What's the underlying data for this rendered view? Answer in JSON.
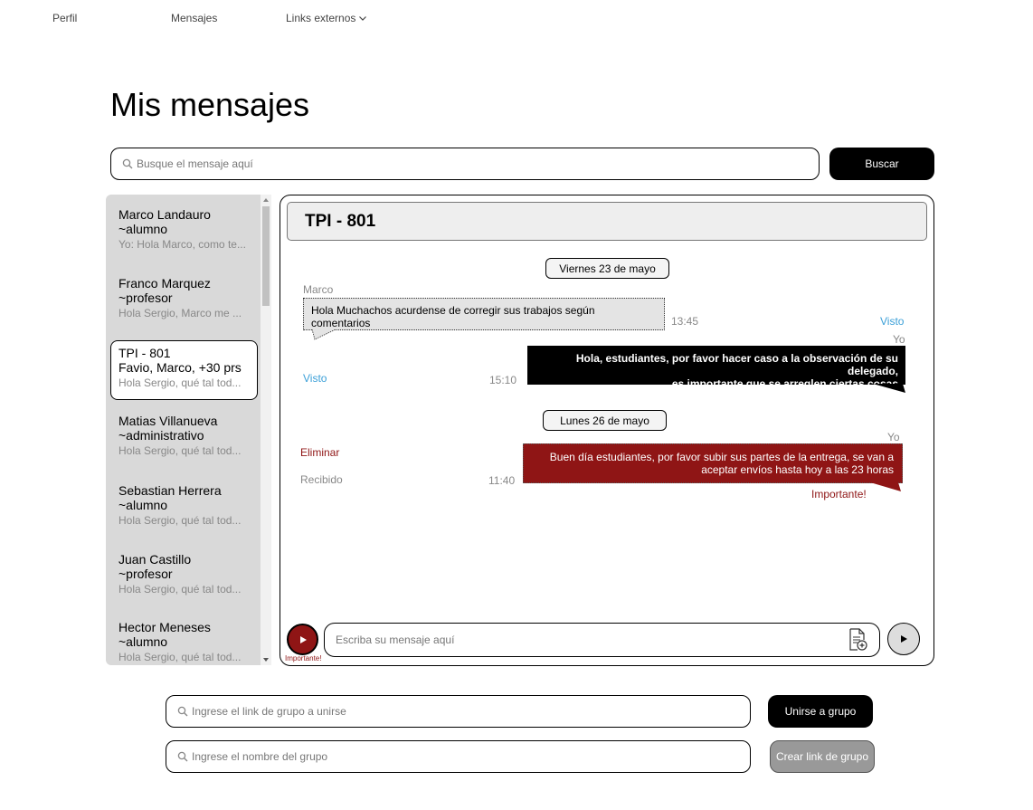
{
  "nav": {
    "perfil": "Perfil",
    "mensajes": "Mensajes",
    "links_externos": "Links externos"
  },
  "page_title": "Mis mensajes",
  "search": {
    "placeholder": "Busque el mensaje aquí",
    "button_label": "Buscar"
  },
  "contacts": [
    {
      "name": "Marco Landauro",
      "role": "~alumno",
      "preview": "Yo: Hola Marco, como te..."
    },
    {
      "name": "Franco Marquez",
      "role": "~profesor",
      "preview": "Hola Sergio, Marco me ..."
    },
    {
      "name": "TPI - 801",
      "role": "Favio, Marco, +30 prs",
      "preview": "Hola Sergio, qué tal tod..."
    },
    {
      "name": "Matias Villanueva",
      "role": "~administrativo",
      "preview": "Hola Sergio, qué tal tod..."
    },
    {
      "name": "Sebastian Herrera",
      "role": "~alumno",
      "preview": "Hola Sergio, qué tal tod..."
    },
    {
      "name": "Juan Castillo",
      "role": "~profesor",
      "preview": "Hola Sergio, qué tal tod..."
    },
    {
      "name": "Hector Meneses",
      "role": "~alumno",
      "preview": "Hola Sergio, qué tal tod..."
    }
  ],
  "chat": {
    "title": "TPI - 801",
    "date_1": "Viernes 23 de mayo",
    "date_2": "Lunes 26 de mayo",
    "msg1": {
      "sender": "Marco",
      "text": "Hola Muchachos acurdense de corregir sus trabajos según comentarios",
      "time": "13:45",
      "status": "Visto"
    },
    "msg2": {
      "sender": "Yo",
      "text_line1": "Hola, estudiantes, por favor hacer caso a la observación de su delegado,",
      "text_line2": "es importante que se arreglen ciertas cosas",
      "time": "15:10",
      "status": "Visto"
    },
    "msg3": {
      "sender": "Yo",
      "text_line1": "Buen día estudiantes, por favor subir sus partes de la entrega, se van a",
      "text_line2": "aceptar envíos hasta hoy a las 23 horas",
      "time": "11:40",
      "delete_label": "Eliminar",
      "status": "Recibido",
      "important_label": "Importante!"
    },
    "composer": {
      "important_label": "Importante!",
      "placeholder": "Escriba su mensaje aquí"
    }
  },
  "join_group": {
    "placeholder": "Ingrese el link de grupo a unirse",
    "button_label": "Unirse a grupo"
  },
  "create_group": {
    "placeholder": "Ingrese el nombre del grupo",
    "button_label": "Crear link de grupo"
  },
  "colors": {
    "important_red": "#8f1515",
    "seen_blue": "#3ca0d8",
    "contacts_bg": "#d9d9d9"
  }
}
